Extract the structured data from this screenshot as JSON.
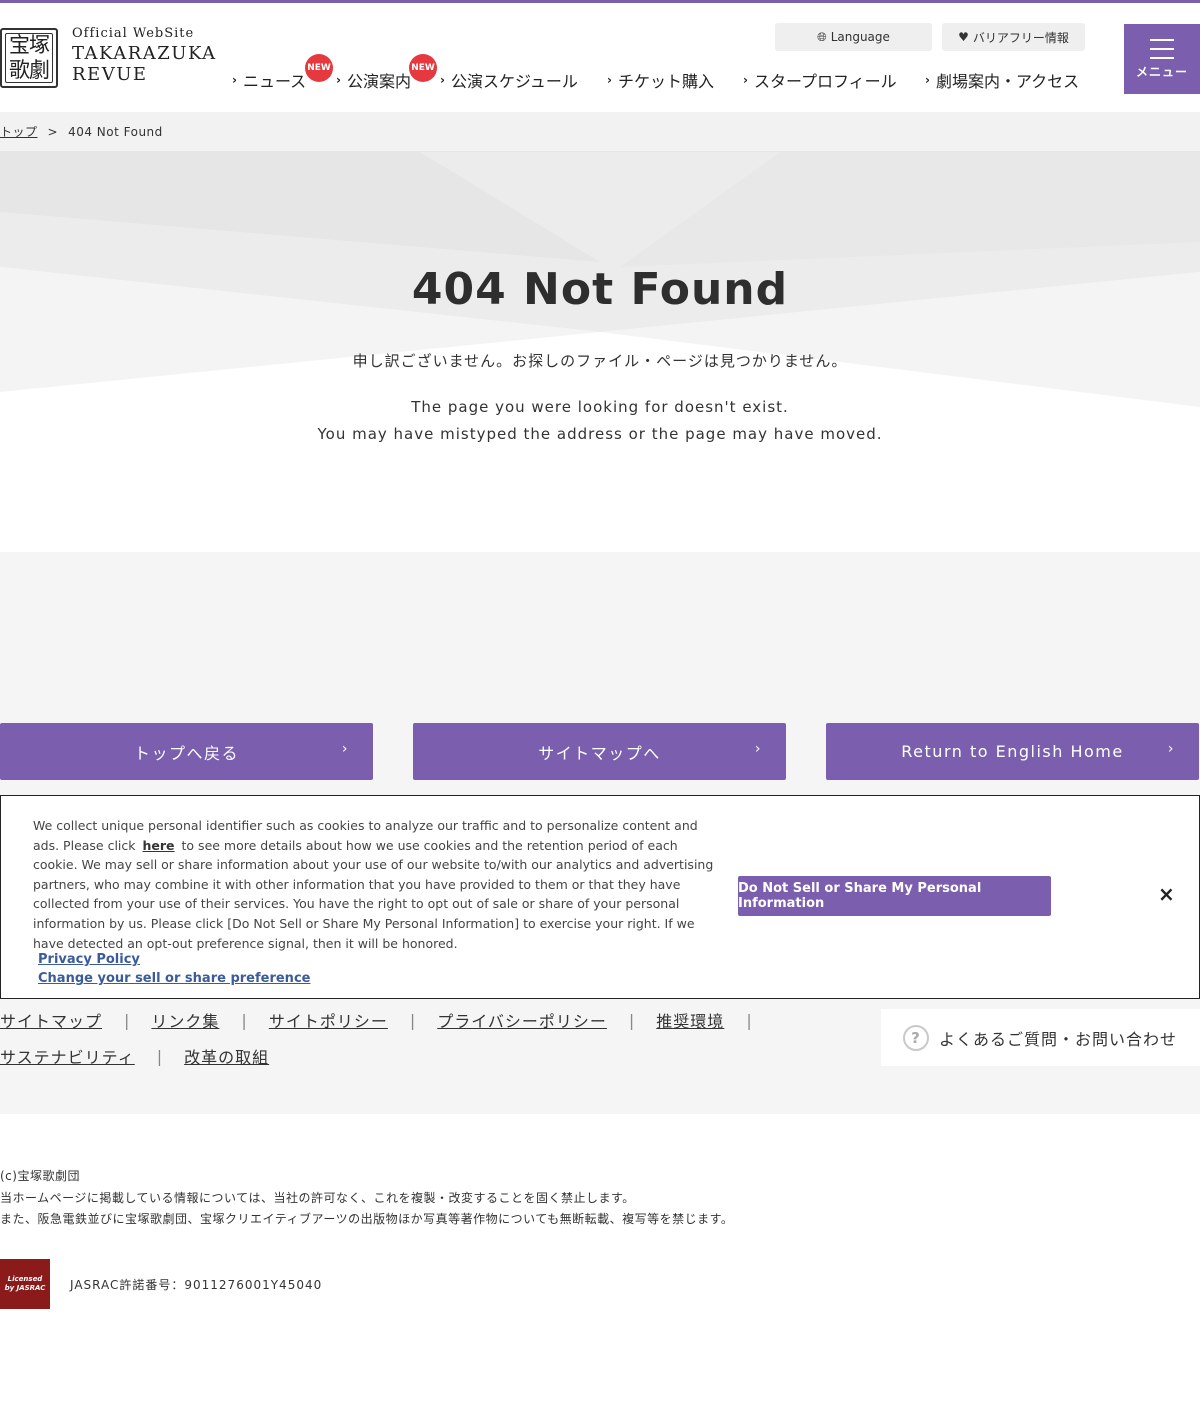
{
  "logo": {
    "mark_line1": "宝塚",
    "mark_line2": "歌劇",
    "official": "Official WebSite",
    "name_line1": "TAKARAZUKA",
    "name_line2": "REVUE"
  },
  "utility": {
    "language": "Language",
    "barrier_free": "バリアフリー情報"
  },
  "nav": {
    "items": [
      {
        "label": "ニュース",
        "badge": "NEW"
      },
      {
        "label": "公演案内",
        "badge": "NEW"
      },
      {
        "label": "公演スケジュール"
      },
      {
        "label": "チケット購入"
      },
      {
        "label": "スタープロフィール"
      },
      {
        "label": "劇場案内・アクセス"
      }
    ],
    "menu_label": "メニュー"
  },
  "breadcrumb": {
    "home": "トップ",
    "separator": ">",
    "current": "404 Not Found"
  },
  "hero": {
    "title": "404 Not Found",
    "message_jp": "申し訳ございません。お探しのファイル・ページは見つかりません。",
    "message_en_1": "The page you were looking for doesn't exist.",
    "message_en_2": "You may have mistyped the address or the page may have moved."
  },
  "cta": {
    "top": "トップへ戻る",
    "sitemap": "サイトマップへ",
    "english": "Return to English Home"
  },
  "cookie": {
    "text_before": "We collect unique personal identifier such as cookies to analyze our traffic and to personalize content and ads. Please click",
    "here": "here",
    "text_after": "to see more details about how we use cookies and the retention period of each cookie. We may sell or share information about your use of our website to/with our analytics and advertising partners, who may combine it with other information that you have provided to them or that they have collected from your use of their services. You have the right to opt out of sale or share of your personal information by us. Please click [Do Not Sell or Share My Personal Information] to exercise your right. If we have detected an opt-out preference signal, then it will be honored.",
    "privacy_policy": "Privacy Policy",
    "change_preference": "Change your sell or share preference",
    "button": "Do Not Sell or Share My Personal Information",
    "close": "×"
  },
  "footer": {
    "links_row1": [
      "サイトマップ",
      "リンク集",
      "サイトポリシー",
      "プライバシーポリシー",
      "推奨環境"
    ],
    "links_row2": [
      "サステナビリティ",
      "改革の取組"
    ],
    "separator": "|",
    "faq": "よくあるご質問・お問い合わせ",
    "faq_icon": "?",
    "copyright": "(c)宝塚歌劇団",
    "notice_1": "当ホームページに掲載している情報については、当社の許可なく、これを複製・改変することを固く禁止します。",
    "notice_2": "また、阪急電鉄並びに宝塚歌劇団、宝塚クリエイティブアーツの出版物ほか写真等著作物についても無断転載、複写等を禁じます。",
    "jasrac_logo_text": "Licensed by JASRAC",
    "jasrac_number": "JASRAC許諾番号：9011276001Y45040"
  },
  "colors": {
    "brand_purple": "#7b5fae",
    "badge_red": "#e5393f"
  }
}
